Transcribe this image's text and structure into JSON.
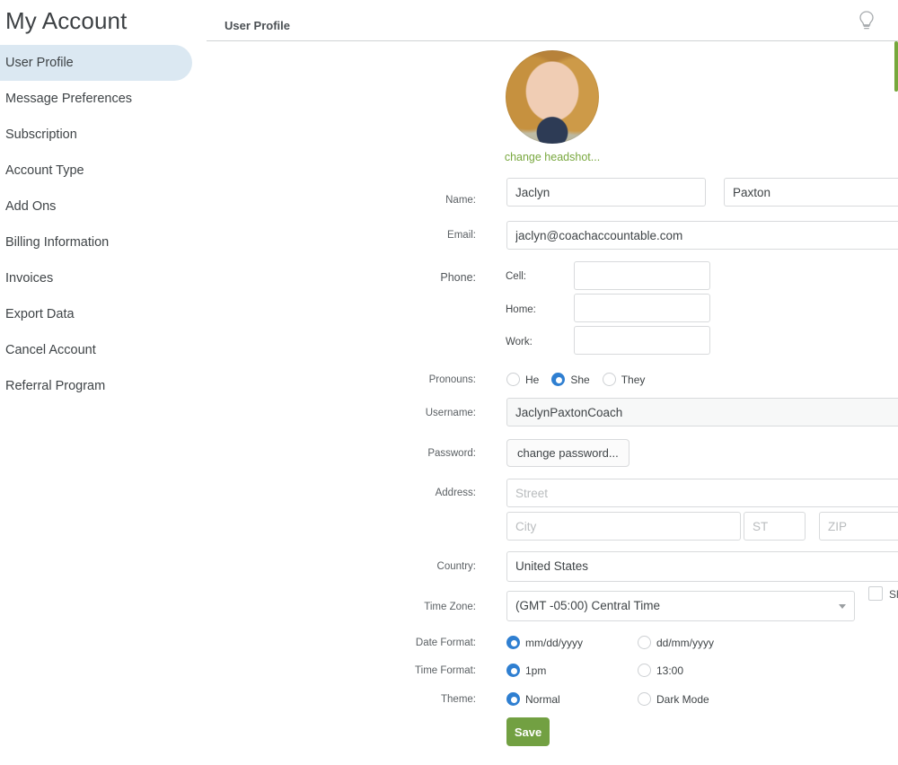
{
  "sidebar": {
    "title": "My Account",
    "items": [
      {
        "label": "User Profile",
        "active": true
      },
      {
        "label": "Message Preferences",
        "active": false
      },
      {
        "label": "Subscription",
        "active": false
      },
      {
        "label": "Account Type",
        "active": false
      },
      {
        "label": "Add Ons",
        "active": false
      },
      {
        "label": "Billing Information",
        "active": false
      },
      {
        "label": "Invoices",
        "active": false
      },
      {
        "label": "Export Data",
        "active": false
      },
      {
        "label": "Cancel Account",
        "active": false
      },
      {
        "label": "Referral Program",
        "active": false
      }
    ]
  },
  "header": {
    "tab_label": "User Profile",
    "help_icon": "lightbulb-icon"
  },
  "avatar": {
    "change_link": "change headshot..."
  },
  "form": {
    "name": {
      "label": "Name:",
      "first_value": "Jaclyn",
      "last_value": "Paxton"
    },
    "email": {
      "label": "Email:",
      "value": "jaclyn@coachaccountable.com"
    },
    "phone": {
      "label": "Phone:",
      "cell_label": "Cell:",
      "cell_value": "",
      "home_label": "Home:",
      "home_value": "",
      "work_label": "Work:",
      "work_value": ""
    },
    "pronouns": {
      "label": "Pronouns:",
      "options": [
        {
          "label": "He",
          "selected": false
        },
        {
          "label": "She",
          "selected": true
        },
        {
          "label": "They",
          "selected": false
        }
      ]
    },
    "username": {
      "label": "Username:",
      "value": "JaclynPaxtonCoach"
    },
    "password": {
      "label": "Password:",
      "button_label": "change password..."
    },
    "address": {
      "label": "Address:",
      "street_placeholder": "Street",
      "street_value": "",
      "city_placeholder": "City",
      "city_value": "",
      "state_placeholder": "ST",
      "state_value": "",
      "zip_placeholder": "ZIP",
      "zip_value": ""
    },
    "country": {
      "label": "Country:",
      "value": "United States"
    },
    "timezone": {
      "label": "Time Zone:",
      "value": "(GMT -05:00) Central Time",
      "show_all_label": "Show All",
      "show_all_checked": false
    },
    "date_format": {
      "label": "Date Format:",
      "options": [
        {
          "label": "mm/dd/yyyy",
          "selected": true
        },
        {
          "label": "dd/mm/yyyy",
          "selected": false
        }
      ]
    },
    "time_format": {
      "label": "Time Format:",
      "options": [
        {
          "label": "1pm",
          "selected": true
        },
        {
          "label": "13:00",
          "selected": false
        }
      ]
    },
    "theme": {
      "label": "Theme:",
      "options": [
        {
          "label": "Normal",
          "selected": true
        },
        {
          "label": "Dark Mode",
          "selected": false
        }
      ]
    },
    "save_label": "Save"
  },
  "annotation": {
    "arrow_color": "#e03a20",
    "arrow_target": "email-input"
  },
  "colors": {
    "accent_green": "#72a042",
    "link_green": "#79a83f",
    "radio_blue": "#2f7fd1",
    "active_nav_bg": "#dbe8f2",
    "text_dark": "#3f4447",
    "border_gray": "#d8dadc"
  }
}
